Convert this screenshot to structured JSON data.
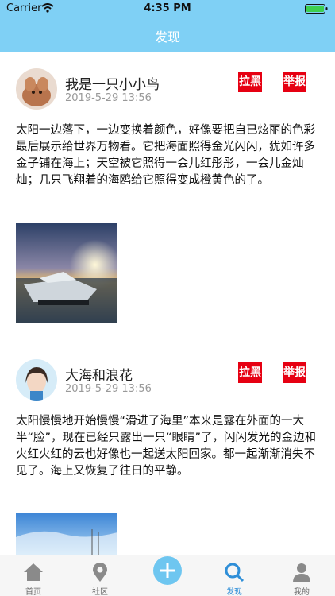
{
  "status_bar": {
    "carrier": "Carrier",
    "time": "4:35 PM"
  },
  "nav": {
    "title": "发现"
  },
  "posts": [
    {
      "username": "我是一只小小鸟",
      "timestamp": "2019-5-29 13:56",
      "block_label": "拉黑",
      "report_label": "举报",
      "text": "太阳一边落下，一边变换着颜色，好像要把自已炫丽的色彩最后展示给世界万物看。它把海面照得金光闪闪，犹如许多金子铺在海上；天空被它照得一会儿红彤彤，一会儿金灿灿；几只飞翔着的海鸥给它照得变成橙黄色的了。"
    },
    {
      "username": "大海和浪花",
      "timestamp": "2019-5-29 13:56",
      "block_label": "拉黑",
      "report_label": "举报",
      "text": "太阳慢慢地开始慢慢“滑进了海里”本来是露在外面的一大半“脸”，现在已经只露出一只“眼睛”了，闪闪发光的金边和火红火红的云也好像也一起送太阳回家。都一起渐渐消失不见了。海上又恢复了往日的平静。"
    }
  ],
  "tabbar": {
    "items": [
      {
        "label": "首页",
        "icon": "home-icon"
      },
      {
        "label": "社区",
        "icon": "location-pin-icon"
      },
      {
        "label": "",
        "icon": "plus-icon"
      },
      {
        "label": "发现",
        "icon": "search-icon"
      },
      {
        "label": "我的",
        "icon": "user-icon"
      }
    ],
    "active_index": 3
  },
  "colors": {
    "header": "#7fd0f5",
    "tag": "#e60012",
    "active_tab": "#2f8fd8"
  }
}
